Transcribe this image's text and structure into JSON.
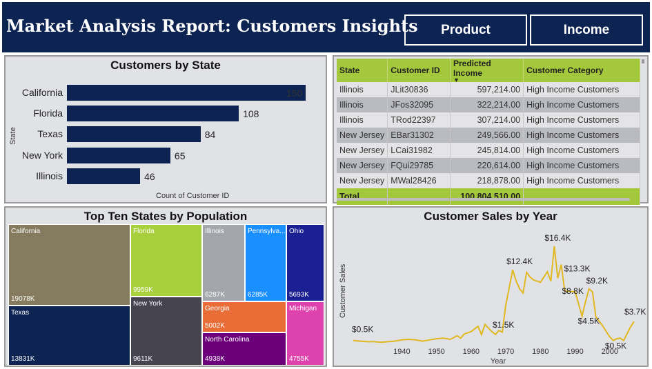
{
  "header": {
    "title": "Market Analysis Report: Customers Insights",
    "buttons": [
      "Product",
      "Income"
    ]
  },
  "colors": {
    "header_bg": "#0d2352",
    "bar": "#0d2352",
    "table_header": "#a4c83b",
    "line": "#e0b81f"
  },
  "bar_panel": {
    "title": "Customers by State",
    "y_title": "State",
    "x_title": "Count of Customer ID"
  },
  "table_panel": {
    "columns": [
      "State",
      "Customer ID",
      "Predicted Income",
      "Customer Category"
    ],
    "rows": [
      [
        "Illinois",
        "JLit30836",
        "597,214.00",
        "High Income Customers"
      ],
      [
        "Illinois",
        "JFos32095",
        "322,214.00",
        "High Income Customers"
      ],
      [
        "Illinois",
        "TRod22397",
        "307,214.00",
        "High Income Customers"
      ],
      [
        "New Jersey",
        "EBar31302",
        "249,566.00",
        "High Income Customers"
      ],
      [
        "New Jersey",
        "LCai31982",
        "245,814.00",
        "High Income Customers"
      ],
      [
        "New Jersey",
        "FQui29785",
        "220,614.00",
        "High Income Customers"
      ],
      [
        "New Jersey",
        "MWal28426",
        "218,878.00",
        "High Income Customers"
      ]
    ],
    "total_label": "Total",
    "total_value": "100,804,510.00"
  },
  "treemap_panel": {
    "title": "Top Ten States by Population"
  },
  "line_panel": {
    "title": "Customer Sales by Year",
    "y_title": "Customer Sales",
    "x_title": "Year"
  },
  "chart_data": [
    {
      "type": "bar",
      "title": "Customers by State",
      "xlabel": "Count of Customer ID",
      "ylabel": "State",
      "categories": [
        "California",
        "Florida",
        "Texas",
        "New York",
        "Illinois"
      ],
      "values": [
        150,
        108,
        84,
        65,
        46
      ],
      "xlim": [
        0,
        150
      ]
    },
    {
      "type": "treemap",
      "title": "Top Ten States by Population",
      "categories": [
        "California",
        "Texas",
        "Florida",
        "New York",
        "Illinois",
        "Pennsylva...",
        "Ohio",
        "Georgia",
        "North Carolina",
        "Michigan"
      ],
      "labels": [
        "19078K",
        "13831K",
        "9959K",
        "9611K",
        "6287K",
        "6285K",
        "5693K",
        "5002K",
        "4938K",
        "4755K"
      ],
      "values": [
        19078,
        13831,
        9959,
        9611,
        6287,
        6285,
        5693,
        5002,
        4938,
        4755
      ],
      "colors": [
        "#857b5e",
        "#0d2352",
        "#a8cf3c",
        "#45444f",
        "#a3a6ab",
        "#1a8fff",
        "#1a1f93",
        "#e86d37",
        "#6b007a",
        "#de43ad"
      ]
    },
    {
      "type": "line",
      "title": "Customer Sales by Year",
      "xlabel": "Year",
      "ylabel": "Customer Sales",
      "xlim": [
        1926,
        2008
      ],
      "ylim": [
        0,
        18
      ],
      "x_ticks": [
        1940,
        1950,
        1960,
        1970,
        1980,
        1990,
        2000
      ],
      "x": [
        1926,
        1928,
        1930,
        1932,
        1934,
        1936,
        1938,
        1940,
        1942,
        1944,
        1946,
        1948,
        1950,
        1952,
        1954,
        1956,
        1957,
        1958,
        1960,
        1962,
        1963,
        1964,
        1966,
        1967,
        1968,
        1969,
        1970,
        1972,
        1973,
        1974,
        1975,
        1976,
        1977,
        1978,
        1980,
        1982,
        1983,
        1984,
        1985,
        1986,
        1987,
        1988,
        1990,
        1992,
        1993,
        1994,
        1995,
        1996,
        1998,
        2000,
        2001,
        2002,
        2003,
        2004,
        2006,
        2007
      ],
      "y": [
        0.5,
        0.4,
        0.3,
        0.3,
        0.2,
        0.3,
        0.4,
        0.6,
        0.7,
        0.6,
        0.4,
        0.6,
        0.8,
        0.9,
        0.7,
        1.3,
        0.9,
        1.6,
        2.0,
        2.9,
        1.5,
        3.2,
        2.0,
        1.5,
        2.2,
        1.9,
        6.5,
        12.4,
        10.5,
        9.2,
        8.5,
        12.0,
        11.2,
        10.7,
        10.3,
        12.1,
        10.5,
        16.4,
        11.0,
        13.3,
        8.8,
        8.8,
        8.7,
        4.6,
        7.0,
        9.2,
        8.7,
        4.5,
        2.9,
        1.1,
        0.5,
        0.8,
        0.9,
        0.5,
        2.8,
        3.7
      ],
      "annotations": [
        {
          "x": 1926,
          "y": 0.5,
          "label": "$0.5K"
        },
        {
          "x": 1969,
          "y": 1.5,
          "label": "$1.5K"
        },
        {
          "x": 1973,
          "y": 12.4,
          "label": "$12.4K"
        },
        {
          "x": 1984,
          "y": 16.4,
          "label": "$16.4K"
        },
        {
          "x": 1986,
          "y": 13.3,
          "label": "$13.3K"
        },
        {
          "x": 1987,
          "y": 8.8,
          "label": "$8.8K"
        },
        {
          "x": 1994,
          "y": 9.2,
          "label": "$9.2K"
        },
        {
          "x": 1992,
          "y": 4.5,
          "label": "$4.5K"
        },
        {
          "x": 2001,
          "y": 0.5,
          "label": "$0.5K"
        },
        {
          "x": 2007,
          "y": 3.7,
          "label": "$3.7K"
        }
      ]
    }
  ]
}
